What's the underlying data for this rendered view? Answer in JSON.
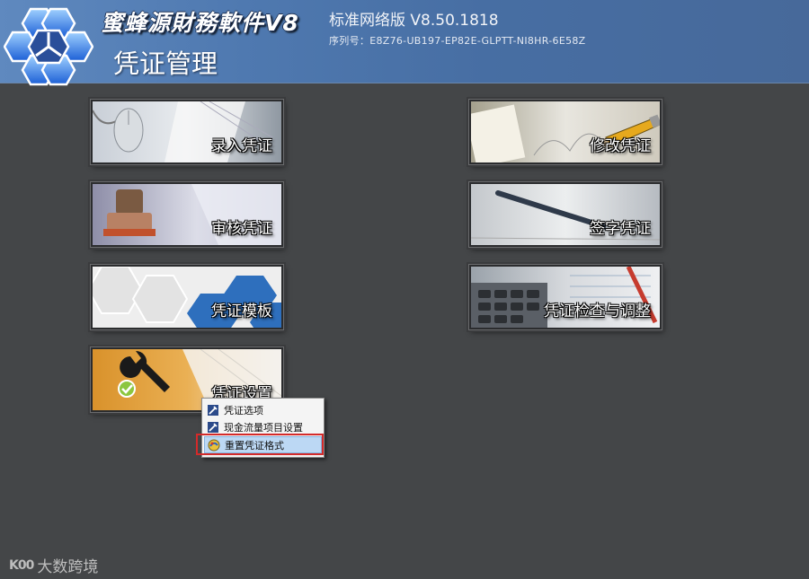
{
  "header": {
    "brand": "蜜蜂源財務軟件V8",
    "edition": "标准网络版 V8.50.1818",
    "serial": "序列号：E8Z76-UB197-EP82E-GLPTT-NI8HR-6E58Z",
    "module_title": "凭证管理"
  },
  "tiles": {
    "entry": "录入凭证",
    "modify": "修改凭证",
    "audit": "审核凭证",
    "sign": "签字凭证",
    "template": "凭证模板",
    "check": "凭证检查与调整",
    "settings": "凭证设置"
  },
  "context_menu": {
    "items": [
      {
        "label": "凭证选项"
      },
      {
        "label": "现金流量项目设置"
      },
      {
        "label": "重置凭证格式",
        "selected": true
      }
    ]
  },
  "watermark": {
    "logo_text": "K00",
    "text": "大数跨境"
  },
  "colors": {
    "background": "#444648",
    "header_blue": "#4f79b0",
    "highlight_red": "#d42a2a",
    "menu_selection": "#bcd8f4",
    "settings_tile": "#e1a63a"
  }
}
